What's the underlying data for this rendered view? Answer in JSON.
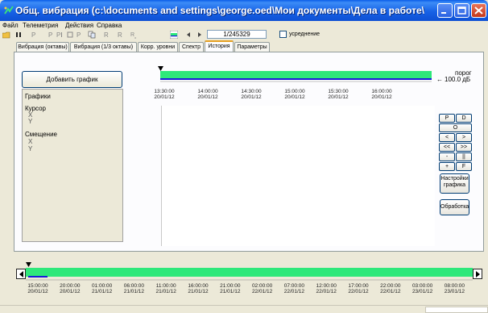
{
  "window": {
    "title": "Общ. вибрация (c:\\documents and settings\\george.oed\\Мои документы\\Дела в работе\\..."
  },
  "menu": [
    "Файл",
    "Телеметрия",
    "Действия",
    "Справка"
  ],
  "toolbar": {
    "tools": [
      "open-icon",
      "stop-icon",
      "p-icon",
      "p-icon",
      "p-bar-icon",
      "square-icon",
      "p-icon",
      "copy-icon",
      "r-icon",
      "r-icon",
      "r-sub-icon",
      "green-bar-icon"
    ],
    "counter": "1/245329",
    "averaging_label": "усреднение",
    "averaging_checked": false
  },
  "tabs": [
    {
      "label": "Вибрация (октавы)",
      "active": false
    },
    {
      "label": "Вибрация (1/3 октавы)",
      "active": false
    },
    {
      "label": "Корр. уровни",
      "active": false
    },
    {
      "label": "Спектр",
      "active": false
    },
    {
      "label": "История",
      "active": true
    },
    {
      "label": "Параметры",
      "active": false
    }
  ],
  "left_panel": {
    "add_button": "Добавить график",
    "graphs_label": "Графики",
    "cursor_label": "Курсор",
    "cursor_x": "X",
    "cursor_y": "Y",
    "offset_label": "Смещение",
    "offset_x": "X",
    "offset_y": "Y"
  },
  "threshold": {
    "label": "порог",
    "value": "100.0 дБ"
  },
  "top_timeline": [
    {
      "time": "13:30:00",
      "date": "20/01/12"
    },
    {
      "time": "14:00:00",
      "date": "20/01/12"
    },
    {
      "time": "14:30:00",
      "date": "20/01/12"
    },
    {
      "time": "15:00:00",
      "date": "20/01/12"
    },
    {
      "time": "15:30:00",
      "date": "20/01/12"
    },
    {
      "time": "16:00:00",
      "date": "20/01/12"
    }
  ],
  "nav_buttons": [
    [
      "P",
      "D"
    ],
    [
      "O"
    ],
    [
      "<",
      ">"
    ],
    [
      "<<",
      ">>"
    ],
    [
      "-",
      "||"
    ],
    [
      "+",
      "F"
    ]
  ],
  "right_buttons": {
    "graph_settings": "Настройки графика",
    "processing": "Обработка"
  },
  "bottom_timeline": [
    {
      "time": "15:00:00",
      "date": "20/01/12"
    },
    {
      "time": "20:00:00",
      "date": "20/01/12"
    },
    {
      "time": "01:00:00",
      "date": "21/01/12"
    },
    {
      "time": "06:00:00",
      "date": "21/01/12"
    },
    {
      "time": "11:00:00",
      "date": "21/01/12"
    },
    {
      "time": "16:00:00",
      "date": "21/01/12"
    },
    {
      "time": "21:00:00",
      "date": "21/01/12"
    },
    {
      "time": "02:00:00",
      "date": "22/01/12"
    },
    {
      "time": "07:00:00",
      "date": "22/01/12"
    },
    {
      "time": "12:00:00",
      "date": "22/01/12"
    },
    {
      "time": "17:00:00",
      "date": "22/01/12"
    },
    {
      "time": "22:00:00",
      "date": "22/01/12"
    },
    {
      "time": "03:00:00",
      "date": "23/01/12"
    },
    {
      "time": "08:00:00",
      "date": "23/01/12"
    }
  ],
  "colors": {
    "title_blue": "#1762e6",
    "timeline_green": "#2ee87a",
    "timeline_blue": "#1a1ad8"
  }
}
